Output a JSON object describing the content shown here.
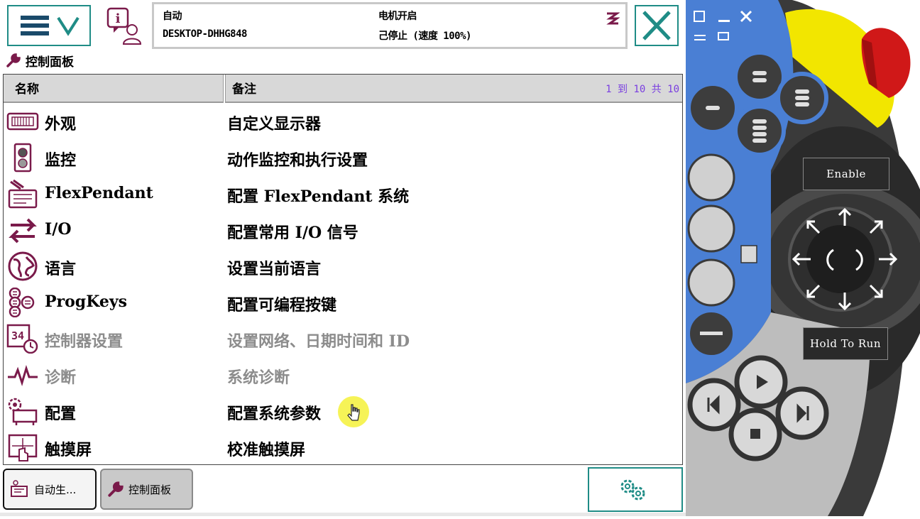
{
  "header": {
    "status": {
      "mode": "自动",
      "system_name": "DESKTOP-DHHG848",
      "motor_state": "电机开启",
      "run_state": "己停止 (速度 100%)"
    },
    "breadcrumb": "控制面板"
  },
  "table": {
    "columns": {
      "name": "名称",
      "note": "备注"
    },
    "pager": "1 到 10 共 10",
    "rows": [
      {
        "name": "外观",
        "note": "自定义显示器",
        "icon": "appearance-icon",
        "enabled": true
      },
      {
        "name": "监控",
        "note": "动作监控和执行设置",
        "icon": "supervision-icon",
        "enabled": true
      },
      {
        "name": "FlexPendant",
        "note": "配置 FlexPendant 系统",
        "icon": "flexpendant-icon",
        "enabled": true
      },
      {
        "name": "I/O",
        "note": "配置常用 I/O 信号",
        "icon": "io-arrows-icon",
        "enabled": true
      },
      {
        "name": "语言",
        "note": "设置当前语言",
        "icon": "globe-icon",
        "enabled": true
      },
      {
        "name": "ProgKeys",
        "note": "配置可编程按键",
        "icon": "progkeys-icon",
        "enabled": true
      },
      {
        "name": "控制器设置",
        "note": "设置网络、日期时间和 ID",
        "icon": "controller-settings-icon",
        "enabled": false
      },
      {
        "name": "诊断",
        "note": "系统诊断",
        "icon": "diagnostics-icon",
        "enabled": false
      },
      {
        "name": "配置",
        "note": "配置系统参数",
        "icon": "configuration-icon",
        "enabled": true
      },
      {
        "name": "触摸屏",
        "note": "校准触摸屏",
        "icon": "touchscreen-icon",
        "enabled": true
      }
    ]
  },
  "taskbar": {
    "tasks": [
      {
        "label": "自动生..."
      },
      {
        "label": "控制面板"
      }
    ]
  },
  "pendant": {
    "enable_label": "Enable",
    "hold_to_run_label": "Hold To Run"
  },
  "colors": {
    "accent": "#1f8c86",
    "icon": "#7a1a4a",
    "pager": "#7a3fe0",
    "pendant_blue": "#4a7fd4",
    "estop_red": "#d01818",
    "estop_yellow": "#f2e600"
  }
}
